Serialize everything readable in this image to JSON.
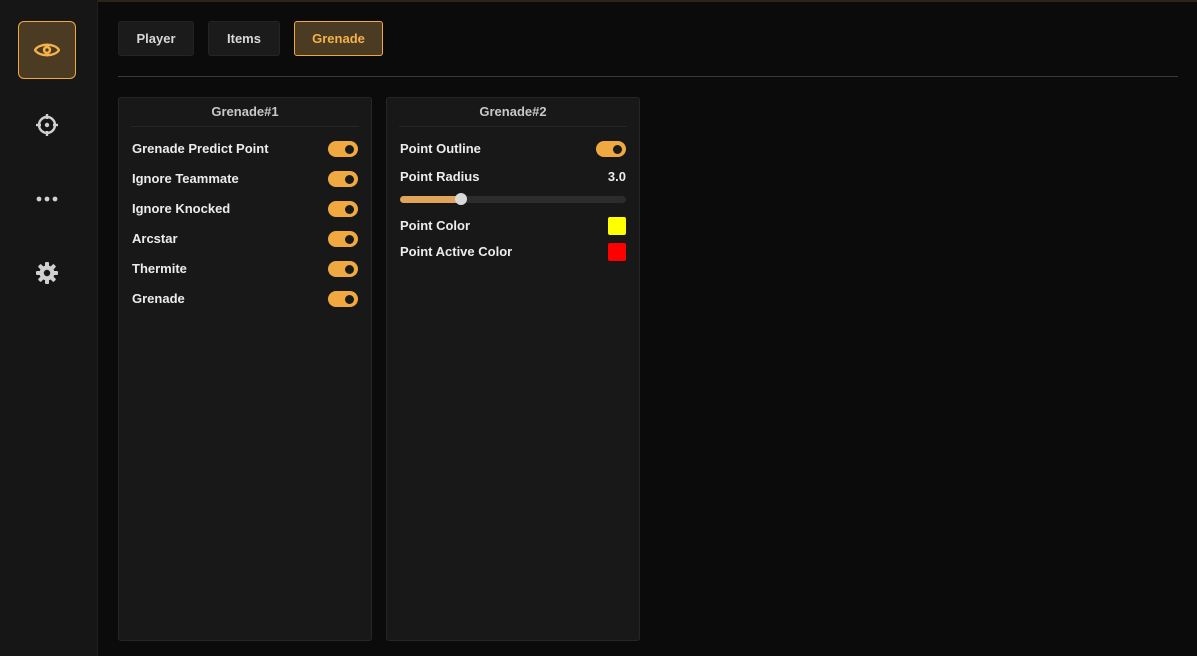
{
  "sidebar": {
    "items": [
      {
        "icon": "eye-icon",
        "active": true
      },
      {
        "icon": "crosshair-icon",
        "active": false
      },
      {
        "icon": "more-dots-icon",
        "active": false
      },
      {
        "icon": "gear-icon",
        "active": false
      }
    ]
  },
  "tabs": [
    {
      "label": "Player",
      "active": false
    },
    {
      "label": "Items",
      "active": false
    },
    {
      "label": "Grenade",
      "active": true
    }
  ],
  "panels": {
    "grenade1": {
      "title": "Grenade#1",
      "toggles": [
        {
          "label": "Grenade Predict Point",
          "on": true
        },
        {
          "label": "Ignore Teammate",
          "on": true
        },
        {
          "label": "Ignore Knocked",
          "on": true
        },
        {
          "label": "Arcstar",
          "on": true
        },
        {
          "label": "Thermite",
          "on": true
        },
        {
          "label": "Grenade",
          "on": true
        }
      ]
    },
    "grenade2": {
      "title": "Grenade#2",
      "point_outline": {
        "label": "Point Outline",
        "on": true
      },
      "point_radius": {
        "label": "Point Radius",
        "value": "3.0",
        "fraction": 0.27
      },
      "point_color": {
        "label": "Point Color",
        "color": "#ffff00"
      },
      "point_active_color": {
        "label": "Point Active Color",
        "color": "#ff0000"
      }
    }
  },
  "colors": {
    "accent": "#f0a840",
    "active_bg": "#4a3b22",
    "panel_bg": "#181818"
  }
}
